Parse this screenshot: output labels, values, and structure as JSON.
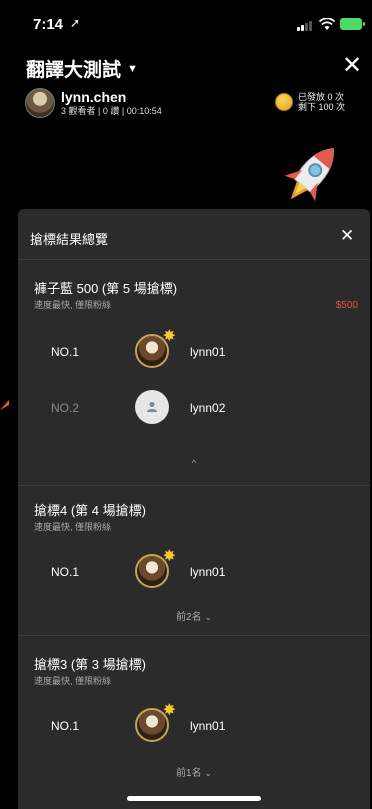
{
  "status_bar": {
    "time": "7:14",
    "location_icon": "location-arrow-icon"
  },
  "header": {
    "room_title": "翻譯大測試",
    "host_name": "lynn.chen",
    "host_meta": "3 觀看者 | 0 讚 | 00:10:54",
    "coins_line1": "已發放 0 次",
    "coins_line2": "剩下 100 次"
  },
  "sheet": {
    "title": "搶標結果總覽",
    "sections": [
      {
        "title": "褲子藍 500 (第 5 場搶標)",
        "subtitle": "速度最快, 僅限粉絲",
        "price": "$500",
        "winners": [
          {
            "rank": "NO.1",
            "user": "lynn01"
          },
          {
            "rank": "NO.2",
            "user": "lynn02"
          }
        ],
        "toggle": "^"
      },
      {
        "title": "搶標4 (第 4 場搶標)",
        "subtitle": "速度最快, 僅限粉絲",
        "winners": [
          {
            "rank": "NO.1",
            "user": "lynn01"
          }
        ],
        "toggle": "前2名"
      },
      {
        "title": "搶標3 (第 3 場搶標)",
        "subtitle": "速度最快, 僅限粉絲",
        "winners": [
          {
            "rank": "NO.1",
            "user": "lynn01"
          }
        ],
        "toggle": "前1名"
      }
    ]
  },
  "colors": {
    "sheet_bg": "#2b2b2b",
    "price": "#e0533f",
    "badge": "#f5c928"
  }
}
